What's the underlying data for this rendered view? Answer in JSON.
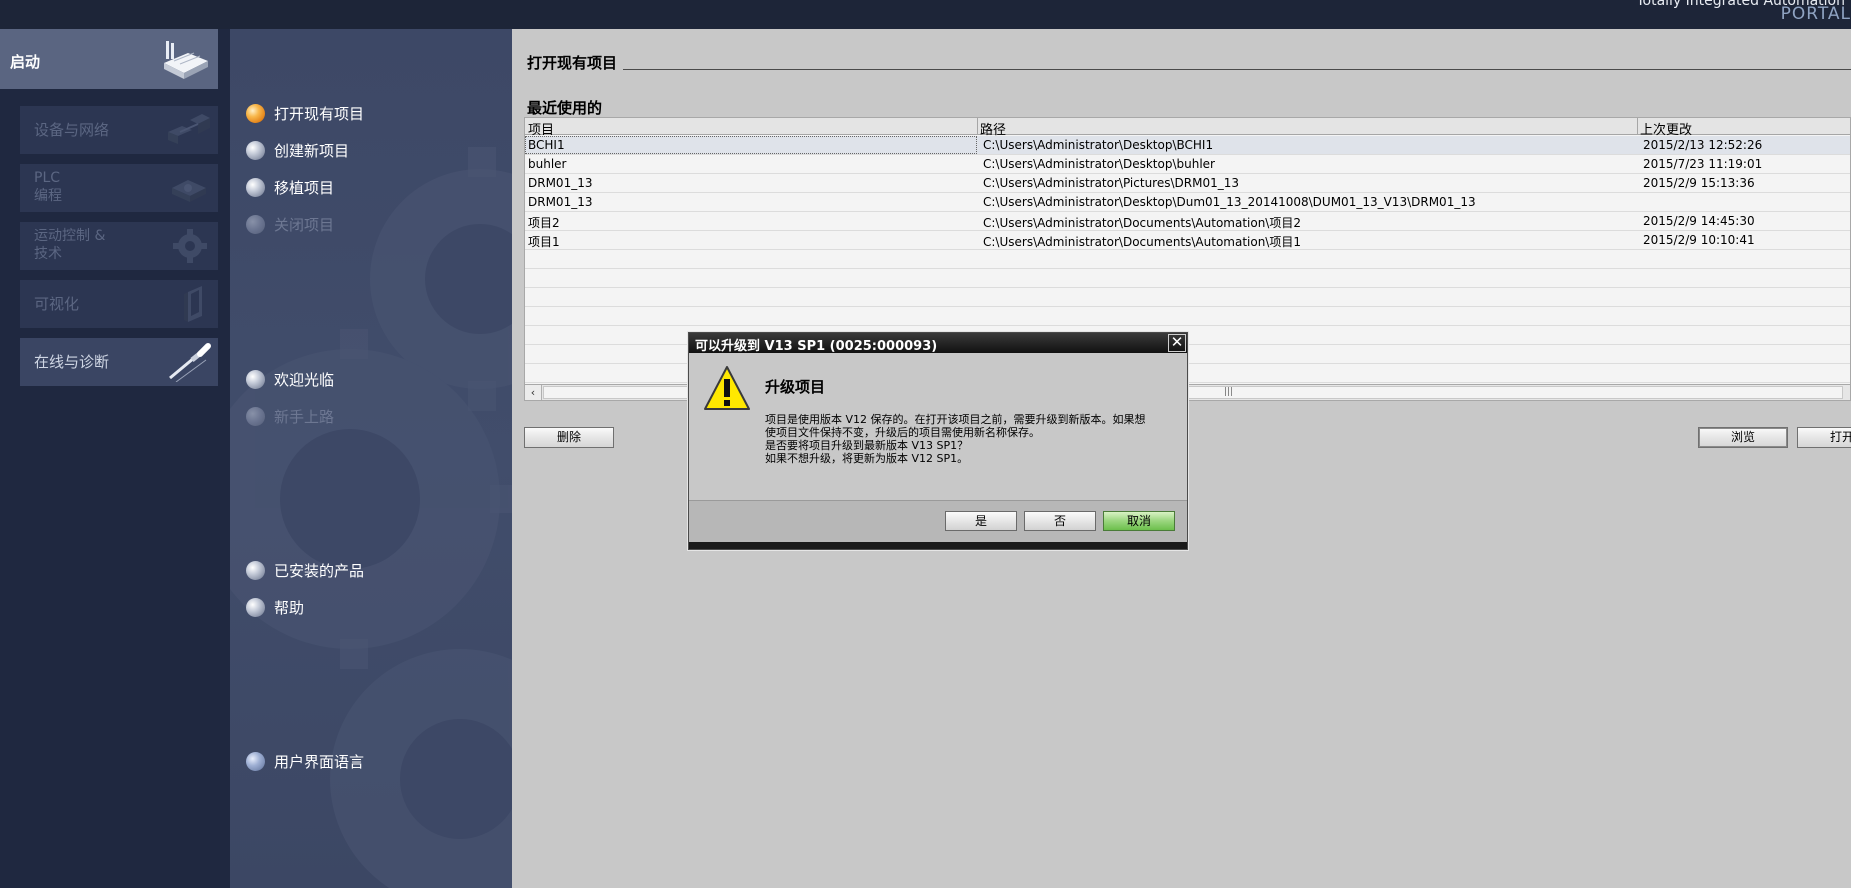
{
  "topbar": {
    "brand_title": "Totally Integrated Automation",
    "brand_sub": "PORTAL"
  },
  "sidebar": {
    "start_label": "启动",
    "items": [
      {
        "label": "设备与网络",
        "icon": "network-devices-icon",
        "enabled": false
      },
      {
        "label": "PLC\n编程",
        "icon": "plc-programming-icon",
        "enabled": false
      },
      {
        "label": "运动控制 &\n技术",
        "icon": "motion-gear-icon",
        "enabled": false
      },
      {
        "label": "可视化",
        "icon": "hmi-panel-icon",
        "enabled": false
      },
      {
        "label": "在线与诊断",
        "icon": "diagnostics-probe-icon",
        "enabled": true
      }
    ]
  },
  "nav": {
    "open_existing": "打开现有项目",
    "create_new": "创建新项目",
    "migrate": "移植项目",
    "close_project": "关闭项目",
    "welcome": "欢迎光临",
    "first_steps": "新手上路",
    "installed_products": "已安装的产品",
    "help": "帮助",
    "ui_language": "用户界面语言"
  },
  "main": {
    "section_title": "打开现有项目",
    "recent_title": "最近使用的",
    "columns": {
      "project": "项目",
      "path": "路径",
      "last_modified": "上次更改"
    },
    "rows": [
      {
        "project": "BCHI1",
        "path": "C:\\Users\\Administrator\\Desktop\\BCHI1",
        "modified": "2015/2/13 12:52:26"
      },
      {
        "project": "buhler",
        "path": "C:\\Users\\Administrator\\Desktop\\buhler",
        "modified": "2015/7/23 11:19:01"
      },
      {
        "project": "DRM01_13",
        "path": "C:\\Users\\Administrator\\Pictures\\DRM01_13",
        "modified": "2015/2/9 15:13:36"
      },
      {
        "project": "DRM01_13",
        "path": "C:\\Users\\Administrator\\Desktop\\Dum01_13_20141008\\DUM01_13_V13\\DRM01_13",
        "modified": ""
      },
      {
        "project": "项目2",
        "path": "C:\\Users\\Administrator\\Documents\\Automation\\项目2",
        "modified": "2015/2/9 14:45:30"
      },
      {
        "project": "项目1",
        "path": "C:\\Users\\Administrator\\Documents\\Automation\\项目1",
        "modified": "2015/2/9 10:10:41"
      }
    ],
    "delete_button": "删除",
    "browse_button": "浏览",
    "open_button": "打开",
    "scroll_grip": "|||"
  },
  "dialog": {
    "title": "可以升级到 V13 SP1 (0025:000093)",
    "close_glyph": "✕",
    "heading": "升级项目",
    "body_lines": [
      "项目是使用版本 V12 保存的。在打开该项目之前，需要升级到新版本。如果想",
      "使项目文件保持不变，升级后的项目需使用新名称保存。",
      "是否要将项目升级到最新版本 V13 SP1？",
      "如果不想升级，将更新为版本 V12 SP1。"
    ],
    "yes_button": "是",
    "no_button": "否",
    "cancel_button": "取消"
  }
}
